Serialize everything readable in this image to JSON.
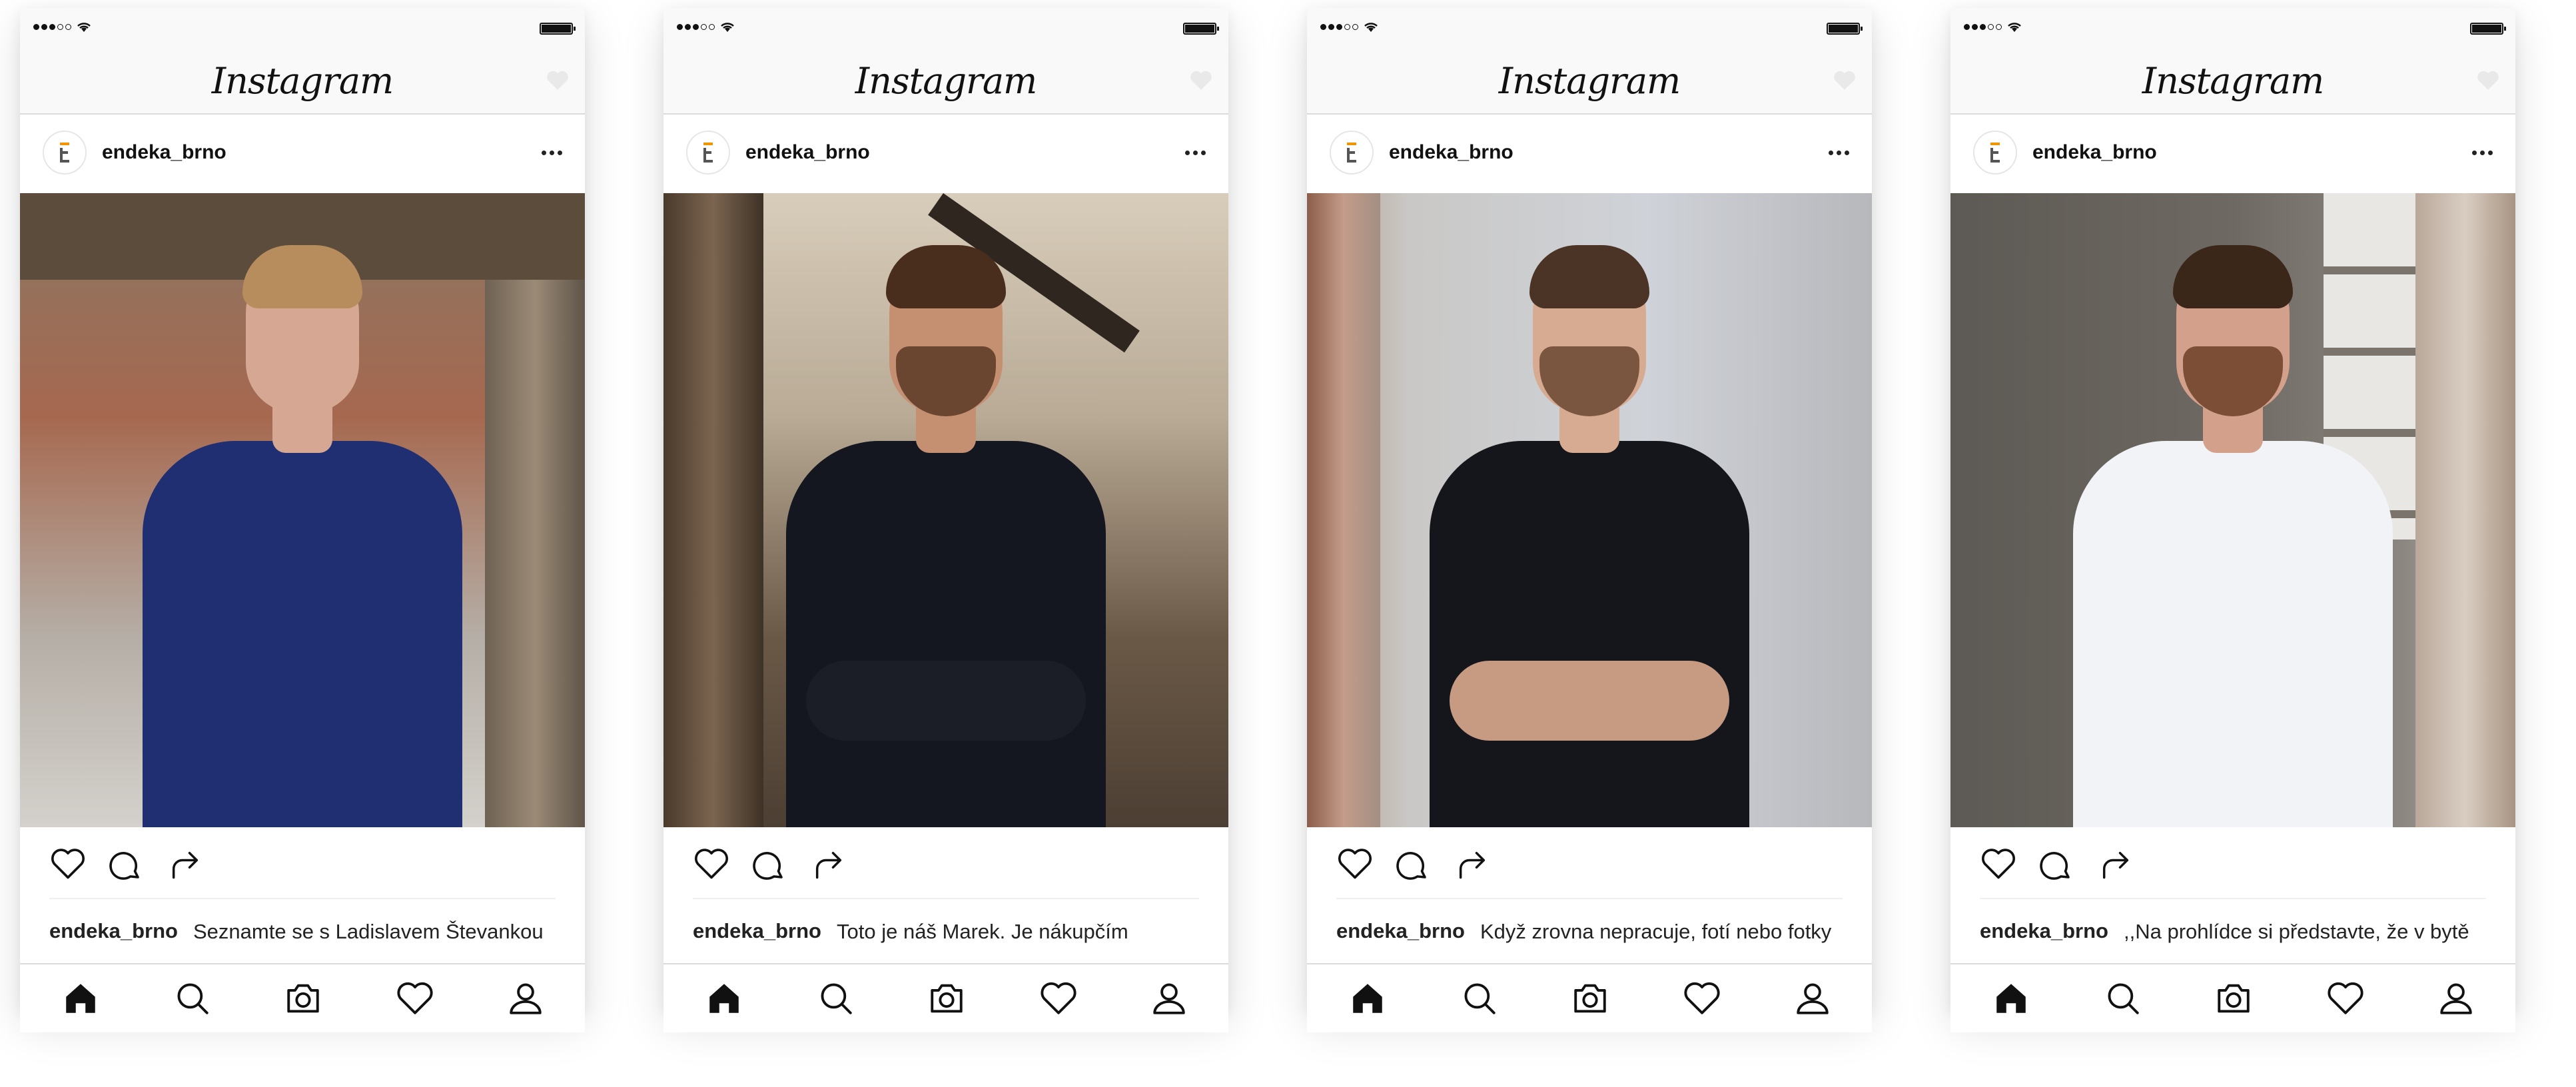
{
  "app": {
    "logo_text": "Instagram"
  },
  "posts": [
    {
      "username": "endeka_brno",
      "caption_user": "endeka_brno",
      "caption_text": "Seznamte se s Ladislavem Števankou",
      "photo_colors": {
        "bg_top": "#8a7764",
        "bg_bottom": "#a89c91",
        "shirt": "#1f2f72",
        "skin": "#d6a893",
        "hair": "#b88d5e"
      }
    },
    {
      "username": "endeka_brno",
      "caption_user": "endeka_brno",
      "caption_text": "Toto je náš Marek. Je nákupčím",
      "photo_colors": {
        "bg_top": "#c4b8a6",
        "bg_bottom": "#6d5c4c",
        "shirt": "#14171f",
        "skin": "#c58f72",
        "hair": "#4a2e1d"
      }
    },
    {
      "username": "endeka_brno",
      "caption_user": "endeka_brno",
      "caption_text": "Když zrovna nepracuje, fotí nebo fotky",
      "photo_colors": {
        "bg_top": "#c8ccd3",
        "bg_bottom": "#b8b9bd",
        "shirt": "#15161b",
        "skin": "#d7ab92",
        "hair": "#4b3426"
      }
    },
    {
      "username": "endeka_brno",
      "caption_user": "endeka_brno",
      "caption_text": ",,Na prohlídce si představte, že v bytě",
      "photo_colors": {
        "bg_top": "#6f6a63",
        "bg_bottom": "#5b5753",
        "shirt": "#f2f3f7",
        "skin": "#d3a18b",
        "hair": "#3b2719"
      }
    }
  ],
  "icons": {
    "like": "heart-icon",
    "comment": "comment-icon",
    "share": "share-icon",
    "home": "home-icon",
    "search": "search-icon",
    "camera": "camera-icon",
    "activity": "heart-icon",
    "profile": "profile-icon"
  }
}
